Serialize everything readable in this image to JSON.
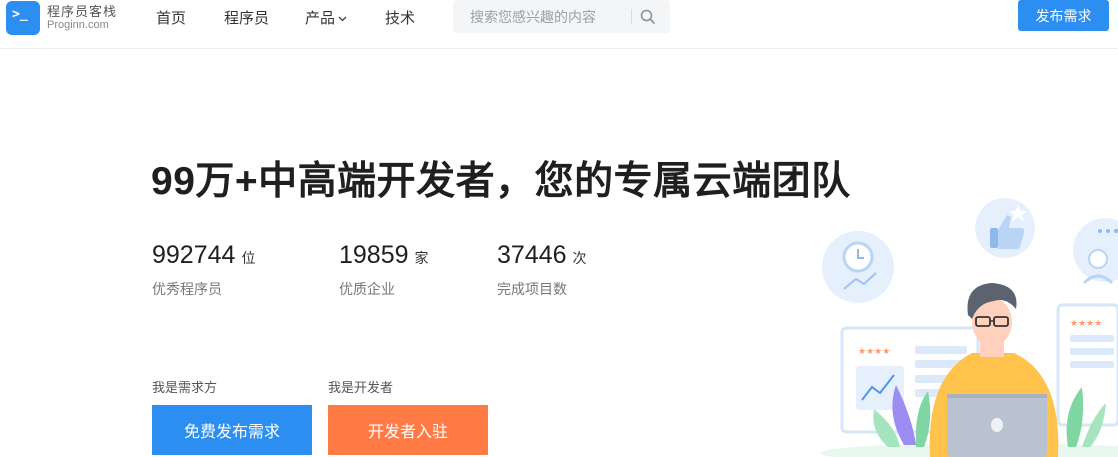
{
  "header": {
    "logo_cn": "程序员客栈",
    "logo_en": "Proginn.com",
    "nav": [
      {
        "label": "首页"
      },
      {
        "label": "程序员"
      },
      {
        "label": "产品"
      },
      {
        "label": "技术"
      }
    ],
    "search": {
      "placeholder": "搜索您感兴趣的内容",
      "value": ""
    },
    "publish_label": "发布需求"
  },
  "hero": {
    "title": "99万+中高端开发者，您的专属云端团队",
    "stats": [
      {
        "number": "992744",
        "unit": "位",
        "label": "优秀程序员"
      },
      {
        "number": "19859",
        "unit": "家",
        "label": "优质企业"
      },
      {
        "number": "37446",
        "unit": "次",
        "label": "完成项目数"
      }
    ],
    "roles": [
      {
        "label": "我是需求方",
        "button": "免费发布需求"
      },
      {
        "label": "我是开发者",
        "button": "开发者入驻"
      }
    ]
  },
  "icons": {
    "logo": "terminal-prompt-icon",
    "nav_caret": "chevron-down-icon",
    "search": "search-icon",
    "illustration": "developer-at-laptop-illustration"
  },
  "colors": {
    "primary": "#2b8ef0",
    "accent": "#ff7a45"
  }
}
